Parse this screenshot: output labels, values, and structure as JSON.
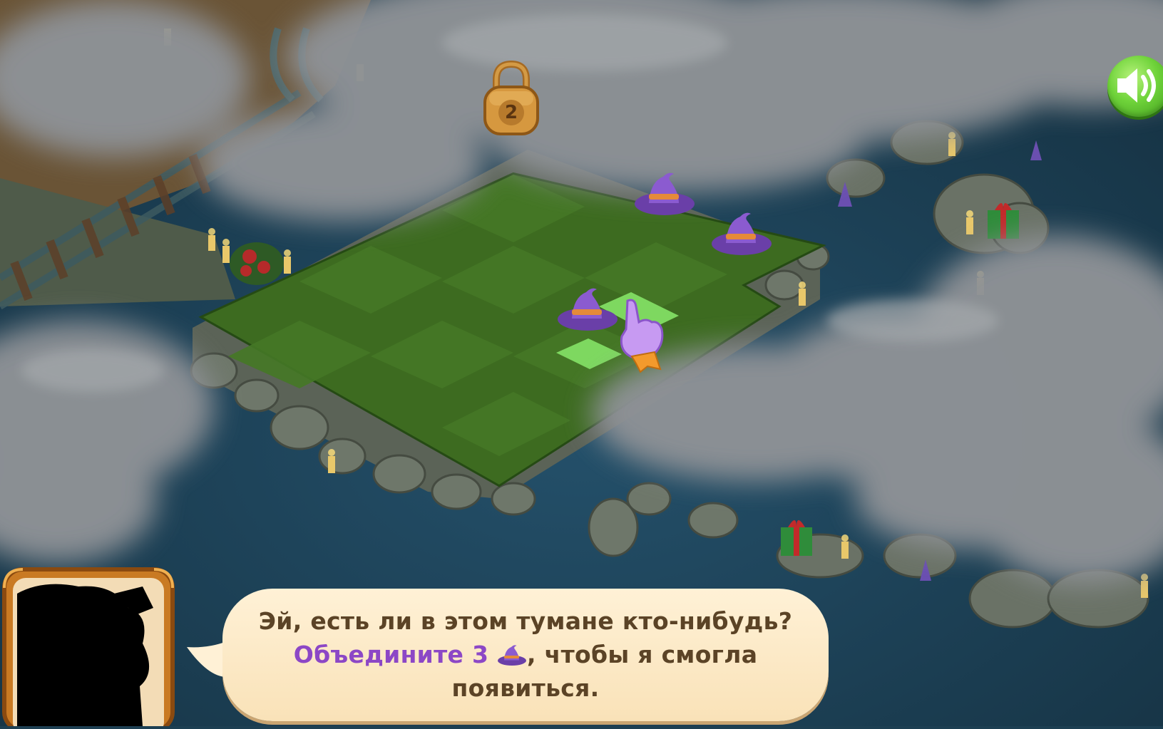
{
  "dialog": {
    "line1": "Эй, есть ли в этом тумане кто-нибудь?",
    "line2_highlight": "Объедините 3",
    "line2_rest": ", чтобы я смогла",
    "line3": "появиться."
  },
  "lock": {
    "count": "2"
  },
  "board": {
    "items": [
      {
        "type": "witch-hat"
      },
      {
        "type": "witch-hat"
      },
      {
        "type": "witch-hat"
      }
    ],
    "merge_hint": "pointing-hand"
  },
  "colors": {
    "water": "#1d3f52",
    "fog": "#8e9296",
    "grass": "#3f6d1f",
    "highlight_tile": "#6fd35a",
    "hat_purple": "#7a4cb8",
    "accent_purple": "#8c47c6",
    "bubble": "#fff1d6",
    "sound_button": "#6fd33a"
  },
  "icons": [
    "speaker-icon",
    "lock-icon",
    "witch-hat-icon",
    "pointing-hand-icon"
  ]
}
